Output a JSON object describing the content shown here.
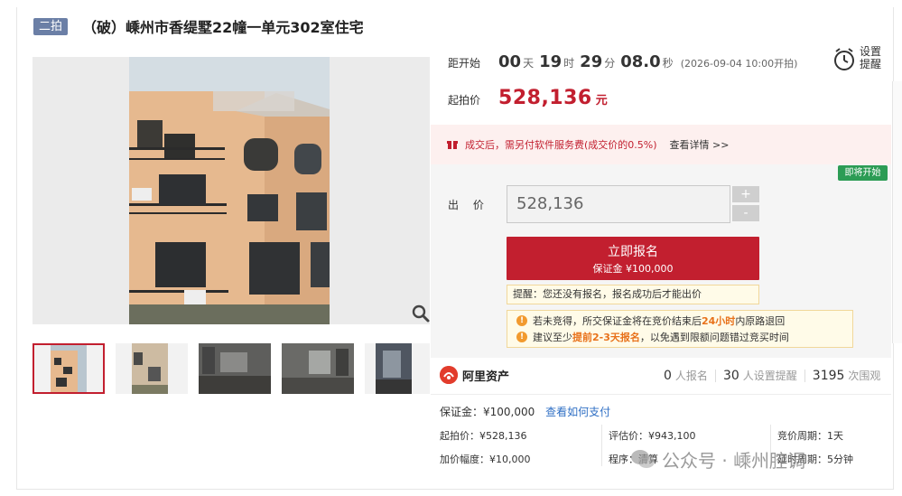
{
  "header": {
    "round_badge": "二拍",
    "title": "（破）嵊州市香缇墅22幢一单元302室住宅"
  },
  "countdown": {
    "label": "距开始",
    "days": "00",
    "days_unit": "天",
    "hours": "19",
    "hours_unit": "时",
    "minutes": "29",
    "minutes_unit": "分",
    "seconds": "08.0",
    "seconds_unit": "秒",
    "start_datetime": "(2026-09-04 10:00开拍)"
  },
  "remind": {
    "label": "设置提醒",
    "icon": "alarm-clock-icon"
  },
  "start_price": {
    "label": "起拍价",
    "value": "528,136",
    "unit": "元"
  },
  "notice": {
    "text": "成交后，需另付软件服务费(成交价的0.5%)",
    "link": "查看详情 >>"
  },
  "bid": {
    "status_badge": "即将开始",
    "label": "出 价",
    "value": "528,136",
    "plus": "+",
    "minus": "-",
    "signup_label": "立即报名",
    "signup_sub": "保证金 ¥100,000",
    "tip": "提醒：您还没有报名，报名成功后才能出价",
    "warnings": [
      {
        "pre": "若未竞得，所交保证金将在竞价结束后",
        "hl": "24小时",
        "post": "内原路退回"
      },
      {
        "pre": "建议至少",
        "hl": "提前2-3天报名",
        "post": "，以免遇到限额问题错过竞买时间"
      }
    ]
  },
  "brand": {
    "name": "阿里资产"
  },
  "stats": [
    {
      "num": "0",
      "label": "人报名"
    },
    {
      "num": "30",
      "label": "人设置提醒"
    },
    {
      "num": "3195",
      "label": "次围观"
    }
  ],
  "deposit": {
    "label": "保证金：¥100,000",
    "link": "查看如何支付"
  },
  "info": {
    "start_price": "起拍价：¥528,136",
    "increment": "加价幅度：¥10,000",
    "appraisal": "评估价：¥943,100",
    "procedure": "程序：清算",
    "cycle": "竞价周期：1天",
    "extension": "延时周期：5分钟"
  },
  "watermark": {
    "text": "公众号 · 嵊州腔调"
  },
  "colors": {
    "accent_red": "#c21f2f",
    "badge_blue": "#6b7fa6",
    "badge_green": "#2c9c55",
    "warning_orange": "#f29a2e"
  }
}
